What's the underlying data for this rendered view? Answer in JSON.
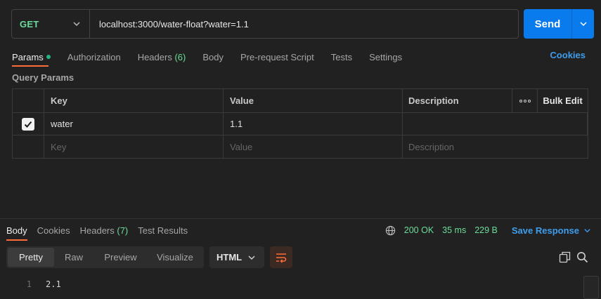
{
  "request": {
    "method": "GET",
    "url": "localhost:3000/water-float?water=1.1",
    "send_label": "Send"
  },
  "request_tabs": {
    "params": "Params",
    "authorization": "Authorization",
    "headers": "Headers",
    "headers_count": "(6)",
    "body": "Body",
    "prerequest": "Pre-request Script",
    "tests": "Tests",
    "settings": "Settings",
    "cookies": "Cookies"
  },
  "query_params": {
    "title": "Query Params",
    "columns": {
      "key": "Key",
      "value": "Value",
      "description": "Description",
      "bulk_edit": "Bulk Edit"
    },
    "rows": [
      {
        "checked": true,
        "key": "water",
        "value": "1.1",
        "description": ""
      }
    ],
    "placeholders": {
      "key": "Key",
      "value": "Value",
      "description": "Description"
    }
  },
  "response": {
    "tabs": {
      "body": "Body",
      "cookies": "Cookies",
      "headers": "Headers",
      "headers_count": "(7)",
      "test_results": "Test Results"
    },
    "status": "200 OK",
    "time": "35 ms",
    "size": "229 B",
    "save_label": "Save Response",
    "views": [
      "Pretty",
      "Raw",
      "Preview",
      "Visualize"
    ],
    "format": "HTML",
    "lines": [
      {
        "number": "1",
        "text": "2.1"
      }
    ]
  },
  "colors": {
    "accent": "#ff6c37",
    "primary": "#097bed",
    "link": "#3f9ded",
    "success": "#6bdd9a"
  }
}
